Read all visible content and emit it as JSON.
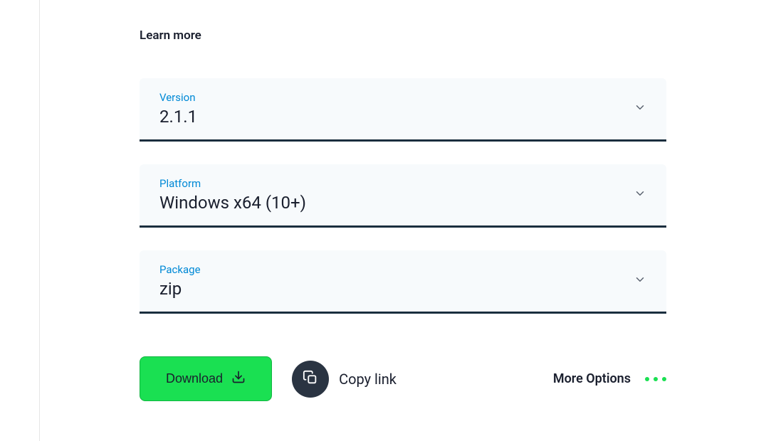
{
  "learnMore": "Learn more",
  "selects": {
    "version": {
      "label": "Version",
      "value": "2.1.1"
    },
    "platform": {
      "label": "Platform",
      "value": "Windows x64 (10+)"
    },
    "package": {
      "label": "Package",
      "value": "zip"
    }
  },
  "actions": {
    "download": "Download",
    "copyLink": "Copy link",
    "moreOptions": "More Options"
  }
}
